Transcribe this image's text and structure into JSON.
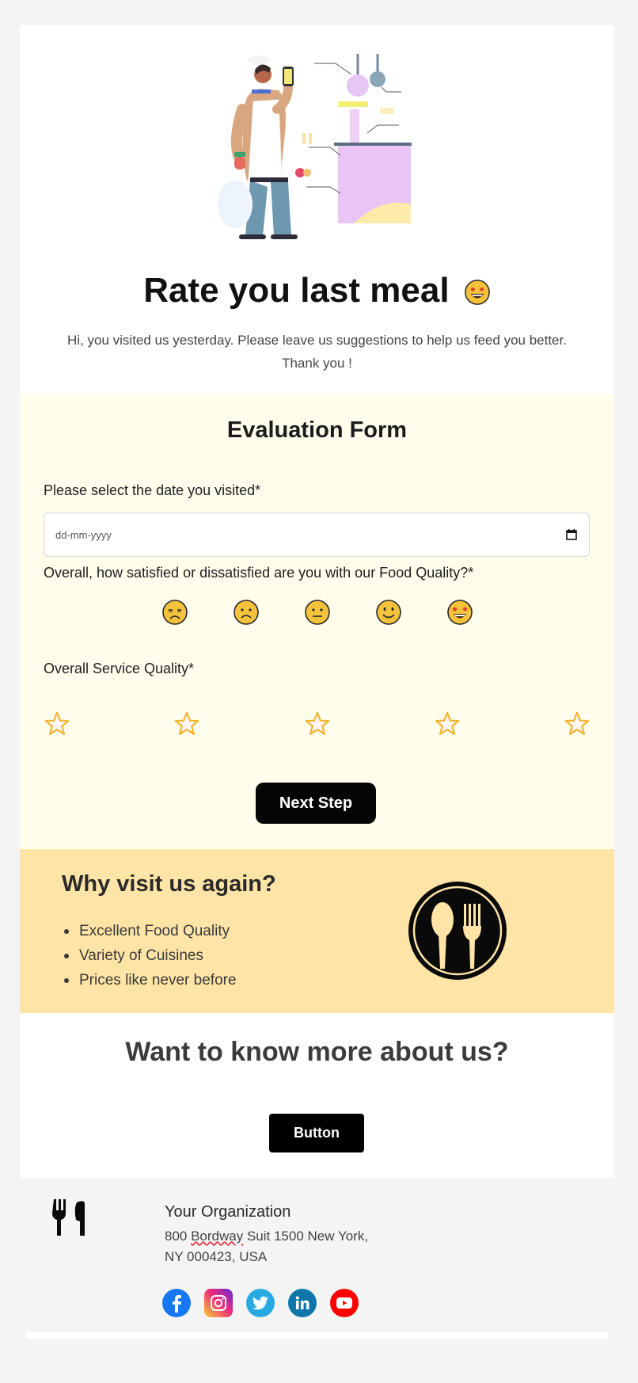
{
  "hero": {
    "illustration": "chef-with-phone-kitchen-illustration",
    "title": "Rate you last meal",
    "title_emoji": "heart-eyes-emoji",
    "subtitle": "Hi, you visited us yesterday. Please leave us suggestions to help us feed you better. Thank you !"
  },
  "form": {
    "title": "Evaluation Form",
    "date_label": "Please select the date you visited*",
    "date_placeholder": "dd-mm-yyyy",
    "date_icon": "calendar-icon",
    "food_label": "Overall, how satisfied or dissatisfied are you with our Food Quality?*",
    "food_options": [
      "very-dissatisfied",
      "dissatisfied",
      "neutral",
      "satisfied",
      "very-satisfied"
    ],
    "service_label": "Overall Service Quality*",
    "service_stars": 5,
    "service_rating": 0,
    "next_label": "Next Step"
  },
  "why": {
    "title": "Why visit us again?",
    "items": [
      "Excellent Food Quality",
      "Variety of Cuisines",
      "Prices like never before"
    ],
    "icon": "spoon-fork-icon"
  },
  "more": {
    "title": "Want to know more about us?",
    "button_label": "Button"
  },
  "footer": {
    "logo_icon": "fork-knife-icon",
    "org_name": "Your Organization",
    "address_line1_pre": "800 ",
    "address_line1_misspelled": "Bordway",
    "address_line1_post": " Suit 1500 New York,",
    "address_line2": "NY 000423, USA",
    "socials": [
      {
        "name": "facebook",
        "color": "#1877f2"
      },
      {
        "name": "instagram",
        "color": "#d6249f"
      },
      {
        "name": "twitter",
        "color": "#1da1f2"
      },
      {
        "name": "linkedin",
        "color": "#0a66c2"
      },
      {
        "name": "youtube",
        "color": "#ff0000"
      }
    ]
  },
  "colors": {
    "page_bg": "#f4f4f5",
    "form_bg": "#fffdeb",
    "why_bg": "#fee4a6",
    "button_bg": "#000000",
    "star": "#f2b630"
  }
}
